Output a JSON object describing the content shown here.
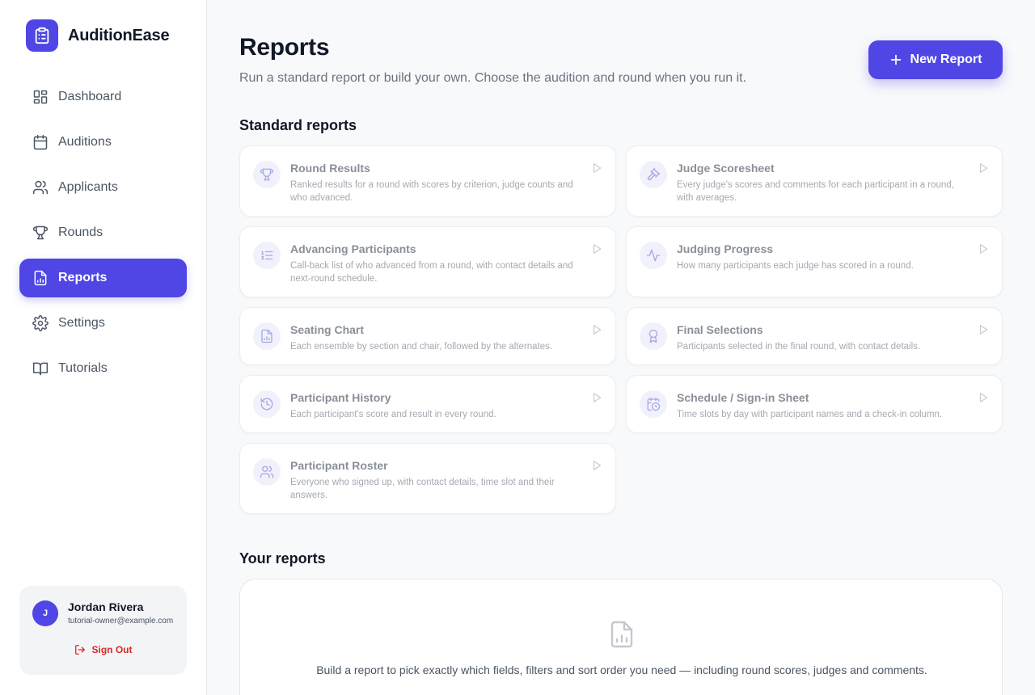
{
  "brand": {
    "name": "AuditionEase"
  },
  "nav": [
    {
      "label": "Dashboard",
      "icon": "dashboard-icon"
    },
    {
      "label": "Auditions",
      "icon": "calendar-icon"
    },
    {
      "label": "Applicants",
      "icon": "users-icon"
    },
    {
      "label": "Rounds",
      "icon": "trophy-icon"
    },
    {
      "label": "Reports",
      "icon": "report-icon",
      "active": true
    },
    {
      "label": "Settings",
      "icon": "gear-icon"
    },
    {
      "label": "Tutorials",
      "icon": "book-icon"
    }
  ],
  "user": {
    "initial": "J",
    "name": "Jordan Rivera",
    "email": "tutorial-owner@example.com",
    "sign_out": "Sign Out"
  },
  "header": {
    "title": "Reports",
    "subtitle": "Run a standard report or build your own. Choose the audition and round when you run it.",
    "new_report": "New Report"
  },
  "standard": {
    "title": "Standard reports",
    "items": [
      {
        "title": "Round Results",
        "desc": "Ranked results for a round with scores by criterion, judge counts and who advanced.",
        "icon": "trophy-icon"
      },
      {
        "title": "Judge Scoresheet",
        "desc": "Every judge's scores and comments for each participant in a round, with averages.",
        "icon": "gavel-icon"
      },
      {
        "title": "Advancing Participants",
        "desc": "Call-back list of who advanced from a round, with contact details and next-round schedule.",
        "icon": "list-ordered-icon"
      },
      {
        "title": "Judging Progress",
        "desc": "How many participants each judge has scored in a round.",
        "icon": "activity-icon"
      },
      {
        "title": "Seating Chart",
        "desc": "Each ensemble by section and chair, followed by the alternates.",
        "icon": "document-chart-icon"
      },
      {
        "title": "Final Selections",
        "desc": "Participants selected in the final round, with contact details.",
        "icon": "award-icon"
      },
      {
        "title": "Participant History",
        "desc": "Each participant's score and result in every round.",
        "icon": "history-icon"
      },
      {
        "title": "Schedule / Sign-in Sheet",
        "desc": "Time slots by day with participant names and a check-in column.",
        "icon": "calendar-clock-icon"
      },
      {
        "title": "Participant Roster",
        "desc": "Everyone who signed up, with contact details, time slot and their answers.",
        "icon": "users-icon"
      }
    ]
  },
  "yours": {
    "title": "Your reports",
    "empty_text": "Build a report to pick exactly which fields, filters and sort order you need — including round scores, judges and comments."
  },
  "colors": {
    "accent": "#4f46e5",
    "danger": "#dc2626"
  }
}
